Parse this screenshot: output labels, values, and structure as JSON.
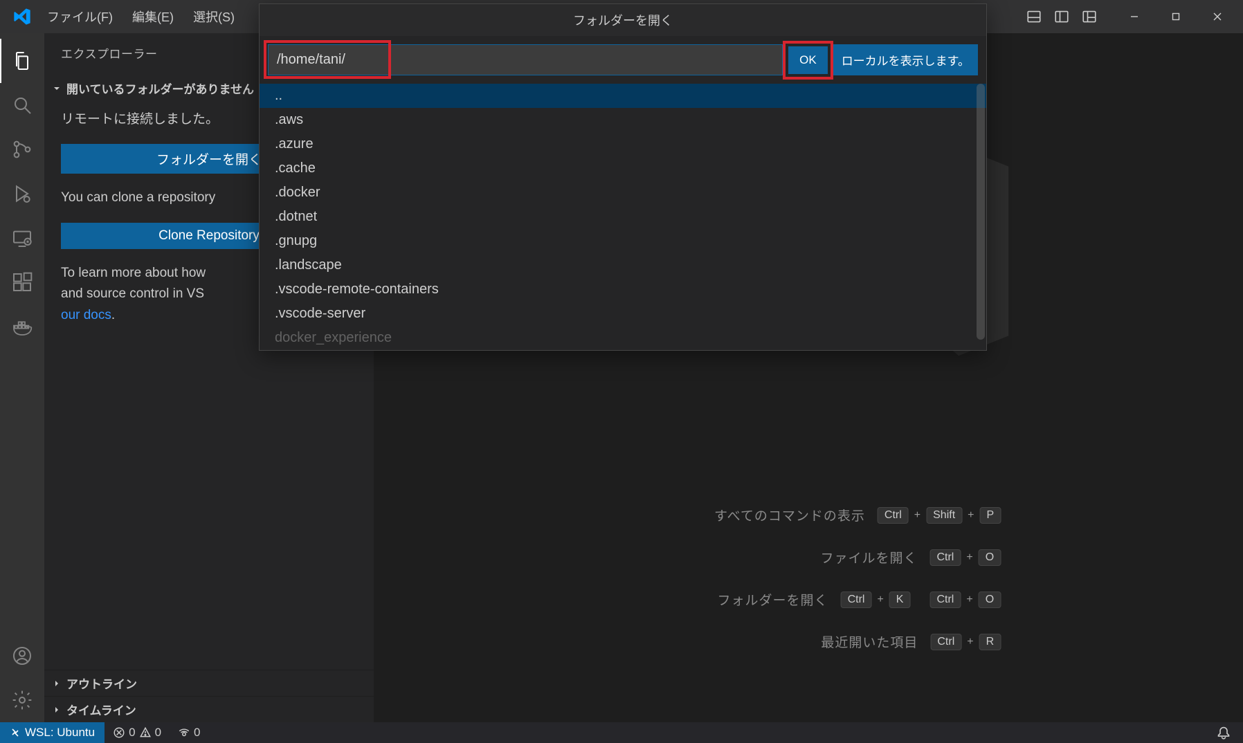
{
  "menubar": {
    "file": "ファイル(F)",
    "edit": "編集(E)",
    "selection": "選択(S)"
  },
  "sidebar": {
    "title": "エクスプローラー",
    "no_folder_header": "開いているフォルダーがありません",
    "connected_msg": "リモートに接続しました。",
    "open_folder_btn": "フォルダーを開く",
    "clone_text": "You can clone a repository",
    "clone_btn": "Clone Repository",
    "learn_text_1": "To learn more about how",
    "learn_text_2": "and source control in VS ",
    "docs_link": "our docs",
    "outline": "アウトライン",
    "timeline": "タイムライン"
  },
  "shortcuts": {
    "show_all": "すべてのコマンドの表示",
    "open_file": "ファイルを開く",
    "open_folder": "フォルダーを開く",
    "recent": "最近開いた項目",
    "ctrl": "Ctrl",
    "shift": "Shift",
    "p": "P",
    "o": "O",
    "k": "K",
    "r": "R",
    "plus": "+"
  },
  "modal": {
    "title": "フォルダーを開く",
    "path": "/home/tani/",
    "ok": "OK",
    "show_local": "ローカルを表示します。",
    "items": [
      "..",
      ".aws",
      ".azure",
      ".cache",
      ".docker",
      ".dotnet",
      ".gnupg",
      ".landscape",
      ".vscode-remote-containers",
      ".vscode-server",
      "docker_experience"
    ]
  },
  "statusbar": {
    "remote_label": "WSL: Ubuntu",
    "errors": "0",
    "warnings": "0",
    "ports": "0"
  }
}
